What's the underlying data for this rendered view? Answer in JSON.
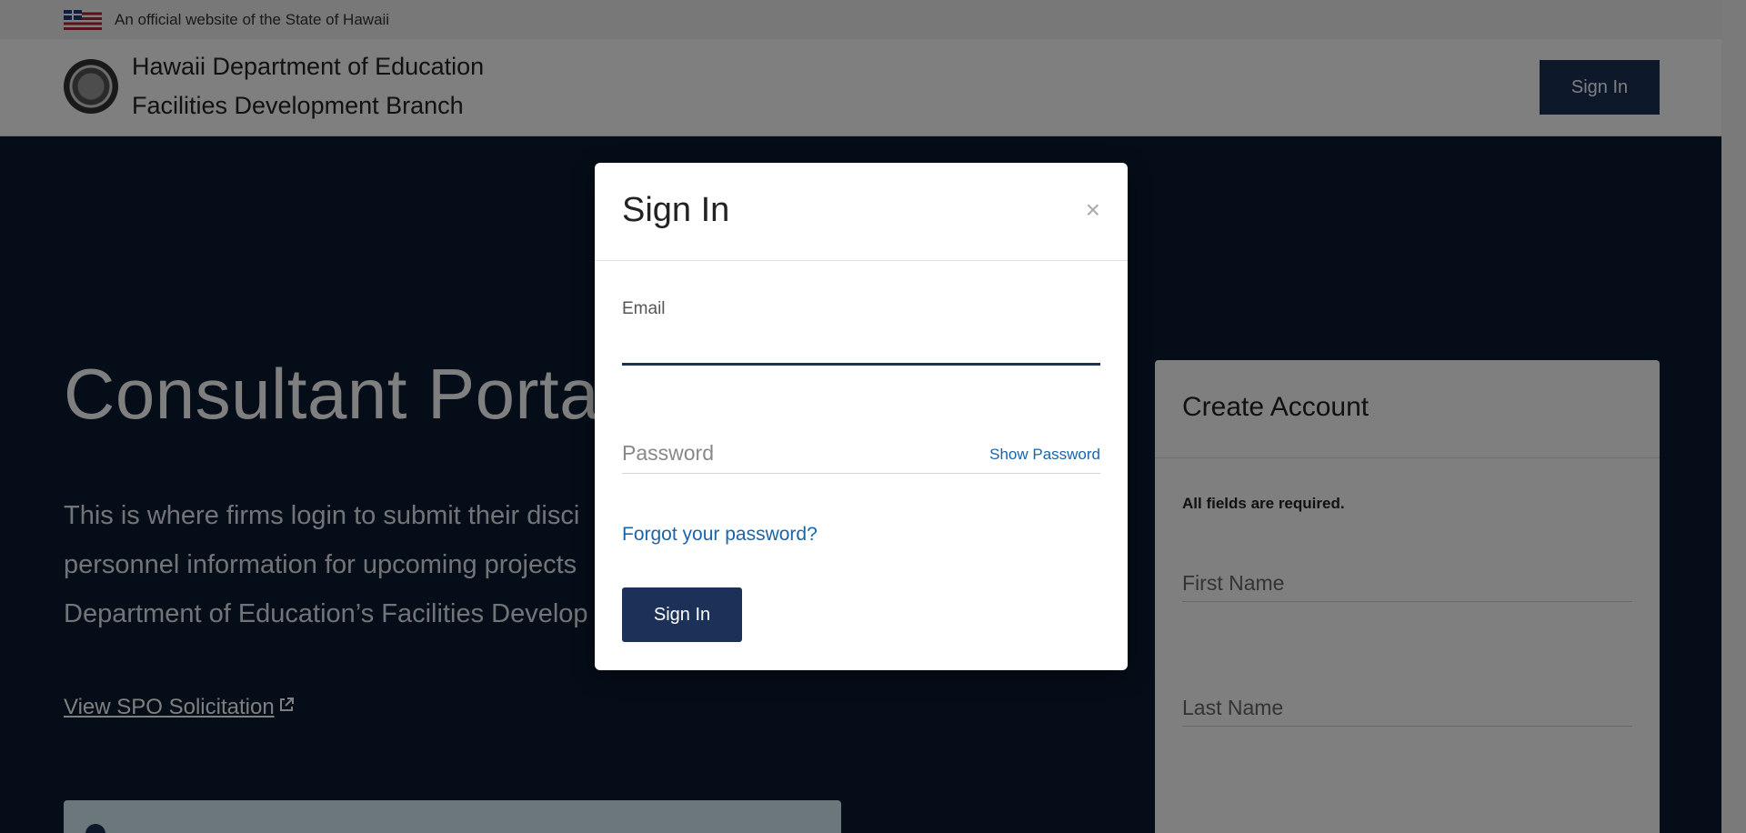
{
  "gov_banner": {
    "text": "An official website of the State of Hawaii"
  },
  "header": {
    "org_line1": "Hawaii Department of Education",
    "org_line2": "Facilities Development Branch",
    "signin_label": "Sign In"
  },
  "hero": {
    "title": "Consultant Portal",
    "text_lines": [
      "This is where firms login to submit their disci",
      "personnel information for upcoming projects",
      "Department of Education’s Facilities Develop"
    ],
    "spo_link": "View SPO Solicitation"
  },
  "create_account": {
    "title": "Create Account",
    "required_note": "All fields are required.",
    "first_name_placeholder": "First Name",
    "last_name_placeholder": "Last Name"
  },
  "modal": {
    "title": "Sign In",
    "close_symbol": "×",
    "email_label": "Email",
    "email_value": "",
    "password_placeholder": "Password",
    "show_password_label": "Show Password",
    "forgot_link": "Forgot your password?",
    "signin_label": "Sign In"
  },
  "colors": {
    "navy": "#1b3157",
    "hero_background": "#0b1a30",
    "link_blue": "#1a65a8"
  }
}
